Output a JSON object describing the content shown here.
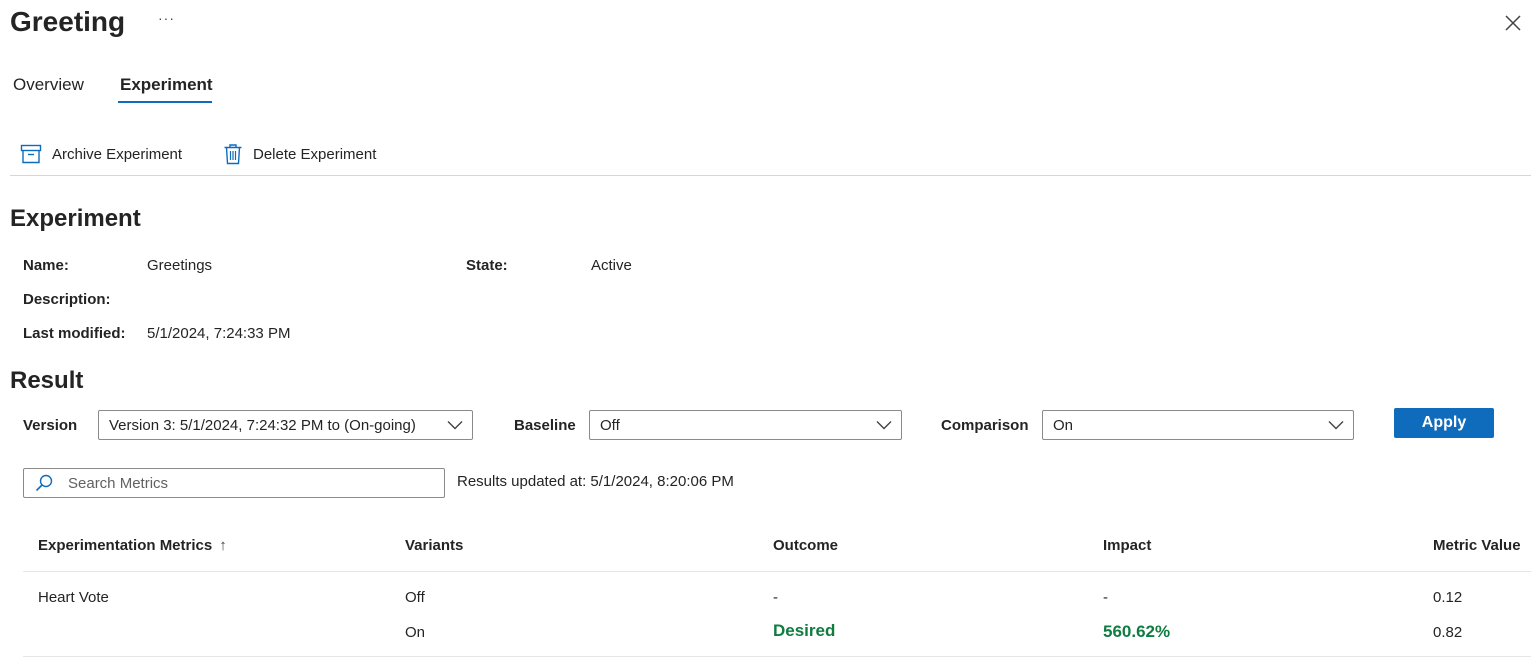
{
  "header": {
    "title": "Greeting",
    "more_label": "···"
  },
  "tabs": [
    {
      "label": "Overview",
      "selected": false
    },
    {
      "label": "Experiment",
      "selected": true
    }
  ],
  "commands": {
    "archive_label": "Archive Experiment",
    "delete_label": "Delete Experiment"
  },
  "experiment": {
    "heading": "Experiment",
    "name_label": "Name:",
    "name_value": "Greetings",
    "state_label": "State:",
    "state_value": "Active",
    "description_label": "Description:",
    "description_value": "",
    "last_modified_label": "Last modified:",
    "last_modified_value": "5/1/2024, 7:24:33 PM"
  },
  "result": {
    "heading": "Result",
    "version_label": "Version",
    "version_value": "Version 3: 5/1/2024, 7:24:32 PM to (On-going)",
    "baseline_label": "Baseline",
    "baseline_value": "Off",
    "comparison_label": "Comparison",
    "comparison_value": "On",
    "apply_label": "Apply",
    "search_placeholder": "Search Metrics",
    "updated_text": "Results updated at: 5/1/2024, 8:20:06 PM"
  },
  "table": {
    "columns": [
      "Experimentation Metrics",
      "Variants",
      "Outcome",
      "Impact",
      "Metric Value"
    ],
    "sort_indicator": "↑",
    "rows": [
      {
        "metric": "Heart Vote",
        "variant": "Off",
        "outcome": "-",
        "impact": "-",
        "value": "0.12"
      },
      {
        "metric": "",
        "variant": "On",
        "outcome": "Desired",
        "impact": "560.62%",
        "value": "0.82"
      }
    ]
  },
  "colors": {
    "accent": "#0f6cbd",
    "positive": "#107c41"
  },
  "icons": [
    "more-icon",
    "close-icon",
    "archive-icon",
    "delete-icon",
    "chevron-down-icon",
    "search-icon",
    "sort-up-icon"
  ]
}
